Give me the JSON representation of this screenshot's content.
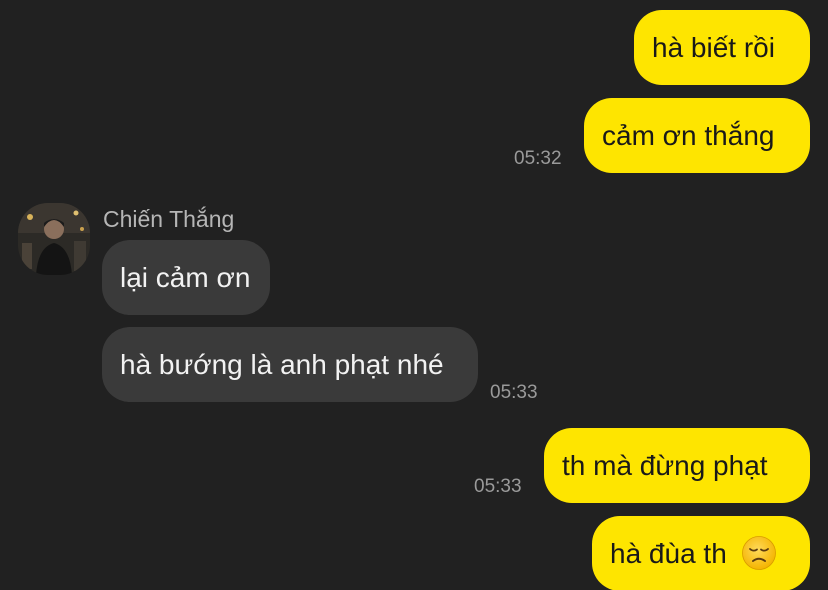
{
  "messages": {
    "m1": "hà biết rồi",
    "m2": "cảm ơn thắng",
    "t1": "05:32",
    "sender": "Chiến Thắng",
    "m3": "lại cảm ơn",
    "m4": "hà bướng là anh phạt nhé",
    "t2": "05:33",
    "m5": "th mà đừng phạt",
    "t3": "05:33",
    "m6": "hà đùa th"
  },
  "emoji": "disappointed-face-icon",
  "colors": {
    "background": "#212121",
    "outgoing_bubble": "#fee500",
    "incoming_bubble": "#3a3a3a",
    "timestamp": "#9a9a9a"
  }
}
